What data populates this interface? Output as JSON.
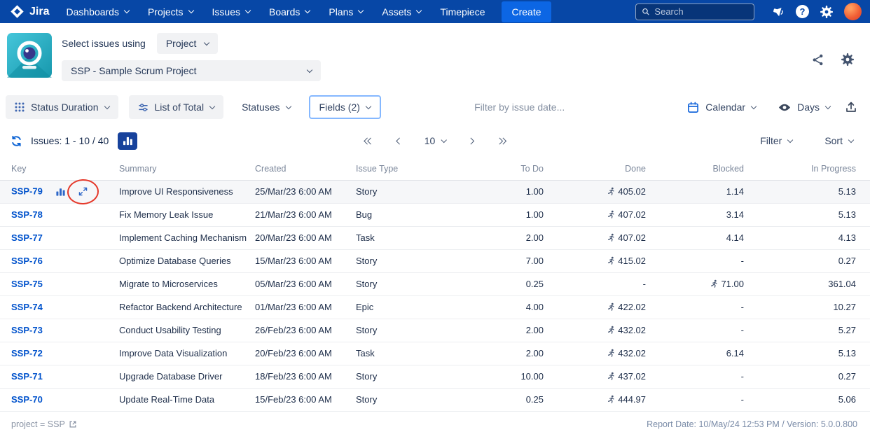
{
  "topnav": {
    "logo_text": "Jira",
    "items": [
      {
        "label": "Dashboards"
      },
      {
        "label": "Projects"
      },
      {
        "label": "Issues"
      },
      {
        "label": "Boards"
      },
      {
        "label": "Plans"
      },
      {
        "label": "Assets"
      },
      {
        "label": "Timepiece"
      }
    ],
    "create_label": "Create",
    "search_placeholder": "Search"
  },
  "app_header": {
    "select_label": "Select issues using",
    "select_value": "Project",
    "project_value": "SSP - Sample Scrum Project"
  },
  "toolbar": {
    "report_type_label": "Status Duration",
    "view_mode_label": "List of Total",
    "statuses_label": "Statuses",
    "fields_label": "Fields (2)",
    "date_filter_placeholder": "Filter by issue date...",
    "calendar_label": "Calendar",
    "unit_label": "Days"
  },
  "pagination": {
    "issues_label": "Issues: 1 - 10 / 40",
    "page_size": "10",
    "filter_label": "Filter",
    "sort_label": "Sort"
  },
  "table": {
    "columns": [
      "Key",
      "Summary",
      "Created",
      "Issue Type",
      "To Do",
      "Done",
      "Blocked",
      "In Progress"
    ],
    "rows": [
      {
        "key": "SSP-79",
        "summary": "Improve UI Responsiveness",
        "created": "25/Mar/23 6:00 AM",
        "issue_type": "Story",
        "to_do": "1.00",
        "done": "405.02",
        "done_has_runner": true,
        "blocked": "1.14",
        "blocked_has_runner": false,
        "in_progress": "5.13",
        "has_row_tools": true,
        "highlighted": true
      },
      {
        "key": "SSP-78",
        "summary": "Fix Memory Leak Issue",
        "created": "21/Mar/23 6:00 AM",
        "issue_type": "Bug",
        "to_do": "1.00",
        "done": "407.02",
        "done_has_runner": true,
        "blocked": "3.14",
        "blocked_has_runner": false,
        "in_progress": "5.13"
      },
      {
        "key": "SSP-77",
        "summary": "Implement Caching Mechanism",
        "created": "20/Mar/23 6:00 AM",
        "issue_type": "Task",
        "to_do": "2.00",
        "done": "407.02",
        "done_has_runner": true,
        "blocked": "4.14",
        "blocked_has_runner": false,
        "in_progress": "4.13"
      },
      {
        "key": "SSP-76",
        "summary": "Optimize Database Queries",
        "created": "15/Mar/23 6:00 AM",
        "issue_type": "Story",
        "to_do": "7.00",
        "done": "415.02",
        "done_has_runner": true,
        "blocked": "-",
        "blocked_has_runner": false,
        "in_progress": "0.27"
      },
      {
        "key": "SSP-75",
        "summary": "Migrate to Microservices",
        "created": "05/Mar/23 6:00 AM",
        "issue_type": "Story",
        "to_do": "0.25",
        "done": "-",
        "done_has_runner": false,
        "blocked": "71.00",
        "blocked_has_runner": true,
        "in_progress": "361.04"
      },
      {
        "key": "SSP-74",
        "summary": "Refactor Backend Architecture",
        "created": "01/Mar/23 6:00 AM",
        "issue_type": "Epic",
        "to_do": "4.00",
        "done": "422.02",
        "done_has_runner": true,
        "blocked": "-",
        "blocked_has_runner": false,
        "in_progress": "10.27"
      },
      {
        "key": "SSP-73",
        "summary": "Conduct Usability Testing",
        "created": "26/Feb/23 6:00 AM",
        "issue_type": "Story",
        "to_do": "2.00",
        "done": "432.02",
        "done_has_runner": true,
        "blocked": "-",
        "blocked_has_runner": false,
        "in_progress": "5.27"
      },
      {
        "key": "SSP-72",
        "summary": "Improve Data Visualization",
        "created": "20/Feb/23 6:00 AM",
        "issue_type": "Task",
        "to_do": "2.00",
        "done": "432.02",
        "done_has_runner": true,
        "blocked": "6.14",
        "blocked_has_runner": false,
        "in_progress": "5.13"
      },
      {
        "key": "SSP-71",
        "summary": "Upgrade Database Driver",
        "created": "18/Feb/23 6:00 AM",
        "issue_type": "Story",
        "to_do": "10.00",
        "done": "437.02",
        "done_has_runner": true,
        "blocked": "-",
        "blocked_has_runner": false,
        "in_progress": "0.27"
      },
      {
        "key": "SSP-70",
        "summary": "Update Real-Time Data",
        "created": "15/Feb/23 6:00 AM",
        "issue_type": "Story",
        "to_do": "0.25",
        "done": "444.97",
        "done_has_runner": true,
        "blocked": "-",
        "blocked_has_runner": false,
        "in_progress": "5.06"
      }
    ]
  },
  "footer": {
    "jql": "project = SSP",
    "report_info": "Report Date: 10/May/24 12:53 PM / Version: 5.0.0.800"
  },
  "colors": {
    "nav_bg": "#0747A6",
    "create_bg": "#0C66E4",
    "link": "#0052CC",
    "annotation_red": "#E5382A",
    "chart_button_bg": "#17429C",
    "icon_blue": "#2E67C8"
  }
}
